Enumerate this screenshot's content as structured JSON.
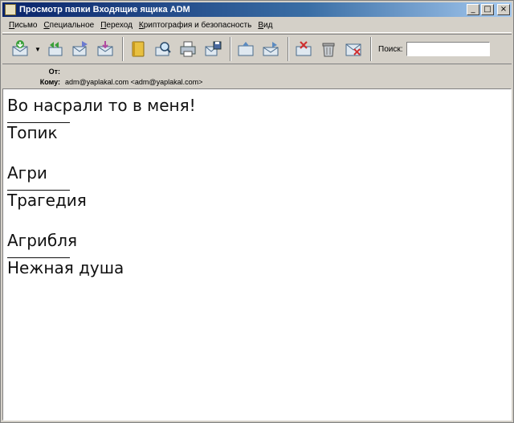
{
  "window": {
    "title": "Просмотр папки Входящие ящика ADM",
    "min_glyph": "_",
    "max_glyph": "□",
    "close_glyph": "×"
  },
  "menu": [
    {
      "ul": "П",
      "rest": "исьмо"
    },
    {
      "ul": "С",
      "rest": "пециальное"
    },
    {
      "ul": "П",
      "rest": "ереход"
    },
    {
      "ul": "К",
      "rest": "риптография и безопасность"
    },
    {
      "ul": "В",
      "rest": "ид"
    }
  ],
  "toolbar": {
    "search_label": "Поиск:",
    "search_value": "",
    "dropdown_glyph": "▼"
  },
  "headers": {
    "from_label": "От:",
    "from_value": "",
    "to_label": "Кому:",
    "to_value": "adm@yaplakal.com <adm@yaplakal.com>"
  },
  "message": {
    "line1": "Во насрали то в меня!",
    "line2": "Топик",
    "line3": "Агри",
    "line4": "Трагедия",
    "line5": "Агрибля",
    "line6": "Нежная душа"
  },
  "colors": {
    "titlebar_start": "#0a246a",
    "titlebar_end": "#a6caf0",
    "chrome": "#d4d0c8"
  }
}
